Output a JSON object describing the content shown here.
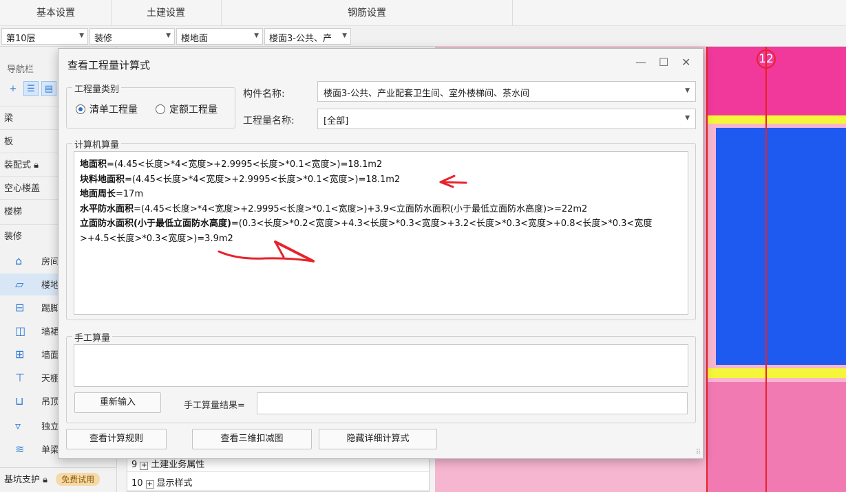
{
  "ribbon": {
    "tabs": [
      "基本设置",
      "土建设置",
      "钢筋设置"
    ]
  },
  "selectors": {
    "floor": "第10层",
    "type": "装修",
    "component": "楼地面",
    "item": "楼面3-公共、产"
  },
  "nav": {
    "title": "导航栏",
    "categories": [
      "梁",
      "板",
      "装配式",
      "空心楼盖",
      "楼梯",
      "装修"
    ],
    "sub_items": [
      {
        "icon": "house-icon",
        "label": "房间"
      },
      {
        "icon": "floor-icon",
        "label": "楼地面"
      },
      {
        "icon": "skirting-icon",
        "label": "踢脚"
      },
      {
        "icon": "wall-skirt-icon",
        "label": "墙裙"
      },
      {
        "icon": "wall-face-icon",
        "label": "墙面"
      },
      {
        "icon": "ceiling-icon",
        "label": "天棚"
      },
      {
        "icon": "suspended-ceiling-icon",
        "label": "吊顶"
      },
      {
        "icon": "column-finish-icon",
        "label": "独立柱装修"
      },
      {
        "icon": "single-beam-icon",
        "label": "单梁装修"
      }
    ],
    "bottom_category": "基坑支护",
    "free_badge": "免费试用"
  },
  "property_table": {
    "rows": [
      {
        "num": "9",
        "toggle": "+",
        "label": "土建业务属性"
      },
      {
        "num": "10",
        "toggle": "+",
        "label": "显示样式"
      }
    ]
  },
  "canvas": {
    "axis_label": "12"
  },
  "dialog": {
    "title": "查看工程量计算式",
    "category_group": {
      "title": "工程量类别",
      "options": [
        {
          "label": "清单工程量",
          "selected": true
        },
        {
          "label": "定额工程量",
          "selected": false
        }
      ]
    },
    "component_name_label": "构件名称:",
    "component_name_value": "楼面3-公共、产业配套卫生间、室外楼梯间、茶水间",
    "quantity_name_label": "工程量名称:",
    "quantity_name_value": "[全部]",
    "computer_calc": {
      "title": "计算机算量",
      "lines": [
        {
          "name": "地面积",
          "expr": "=(4.45<长度>*4<宽度>+2.9995<长度>*0.1<宽度>)=18.1m2"
        },
        {
          "name": "块料地面积",
          "expr": "=(4.45<长度>*4<宽度>+2.9995<长度>*0.1<宽度>)=18.1m2"
        },
        {
          "name": "地面周长",
          "expr": "=17m"
        },
        {
          "name": "水平防水面积",
          "expr": "=(4.45<长度>*4<宽度>+2.9995<长度>*0.1<宽度>)+3.9<立面防水面积(小于最低立面防水高度)>=22m2"
        },
        {
          "name": "立面防水面积(小于最低立面防水高度)",
          "expr": "=(0.3<长度>*0.2<宽度>+4.3<长度>*0.3<宽度>+3.2<长度>*0.3<宽度>+0.8<长度>*0.3<宽度>+4.5<长度>*0.3<宽度>)=3.9m2"
        }
      ]
    },
    "manual_calc": {
      "title": "手工算量",
      "reenter_button": "重新输入",
      "result_label": "手工算量结果=",
      "result_value": ""
    },
    "buttons": {
      "view_rules": "查看计算规则",
      "view_3d": "查看三维扣减图",
      "hide_detail": "隐藏详细计算式"
    }
  },
  "colors": {
    "annotation_red": "#e8222a",
    "canvas_pink": "#f7b6cf",
    "canvas_magenta": "#f0399a",
    "canvas_blue": "#1e5af0",
    "canvas_yellow": "#f5f53a",
    "accent_blue": "#2d6fd2"
  }
}
